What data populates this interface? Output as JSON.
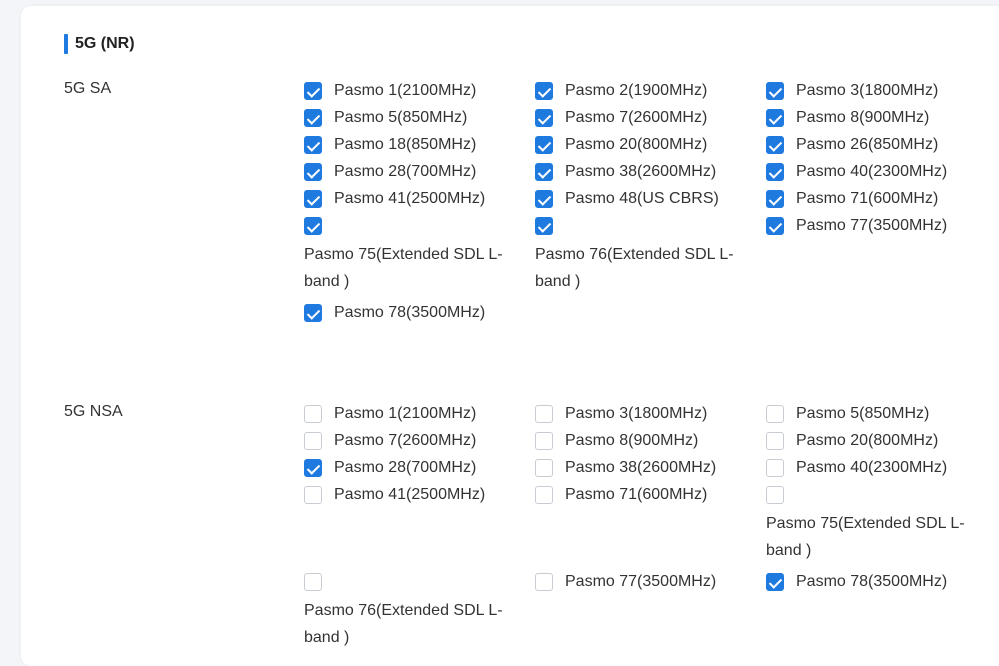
{
  "section_title": "5G (NR)",
  "groups": [
    {
      "label": "5G SA",
      "bands": [
        {
          "label": "Pasmo 1(2100MHz)",
          "checked": true
        },
        {
          "label": "Pasmo 2(1900MHz)",
          "checked": true
        },
        {
          "label": "Pasmo 3(1800MHz)",
          "checked": true
        },
        {
          "label": "Pasmo 5(850MHz)",
          "checked": true
        },
        {
          "label": "Pasmo 7(2600MHz)",
          "checked": true
        },
        {
          "label": "Pasmo 8(900MHz)",
          "checked": true
        },
        {
          "label": "Pasmo 18(850MHz)",
          "checked": true
        },
        {
          "label": "Pasmo 20(800MHz)",
          "checked": true
        },
        {
          "label": "Pasmo 26(850MHz)",
          "checked": true
        },
        {
          "label": "Pasmo 28(700MHz)",
          "checked": true
        },
        {
          "label": "Pasmo 38(2600MHz)",
          "checked": true
        },
        {
          "label": "Pasmo 40(2300MHz)",
          "checked": true
        },
        {
          "label": "Pasmo 41(2500MHz)",
          "checked": true
        },
        {
          "label": "Pasmo 48(US CBRS)",
          "checked": true
        },
        {
          "label": "Pasmo 71(600MHz)",
          "checked": true
        },
        {
          "label": "Pasmo 75(Extended SDL L-band )",
          "checked": true
        },
        {
          "label": "Pasmo 76(Extended SDL L-band )",
          "checked": true
        },
        {
          "label": "Pasmo 77(3500MHz)",
          "checked": true
        },
        {
          "label": "Pasmo 78(3500MHz)",
          "checked": true
        }
      ]
    },
    {
      "label": "5G NSA",
      "bands": [
        {
          "label": "Pasmo 1(2100MHz)",
          "checked": false
        },
        {
          "label": "Pasmo 3(1800MHz)",
          "checked": false
        },
        {
          "label": "Pasmo 5(850MHz)",
          "checked": false
        },
        {
          "label": "Pasmo 7(2600MHz)",
          "checked": false
        },
        {
          "label": "Pasmo 8(900MHz)",
          "checked": false
        },
        {
          "label": "Pasmo 20(800MHz)",
          "checked": false
        },
        {
          "label": "Pasmo 28(700MHz)",
          "checked": true
        },
        {
          "label": "Pasmo 38(2600MHz)",
          "checked": false
        },
        {
          "label": "Pasmo 40(2300MHz)",
          "checked": false
        },
        {
          "label": "Pasmo 41(2500MHz)",
          "checked": false
        },
        {
          "label": "Pasmo 71(600MHz)",
          "checked": false
        },
        {
          "label": "Pasmo 75(Extended SDL L-band )",
          "checked": false
        },
        {
          "label": "Pasmo 76(Extended SDL L-band )",
          "checked": false
        },
        {
          "label": "Pasmo 77(3500MHz)",
          "checked": false
        },
        {
          "label": "Pasmo 78(3500MHz)",
          "checked": true
        }
      ]
    }
  ],
  "colors": {
    "accent": "#1f7ae0",
    "checkbox_border": "#c8ccd3",
    "page_background": "#f3f5f9",
    "card_background": "#ffffff"
  }
}
